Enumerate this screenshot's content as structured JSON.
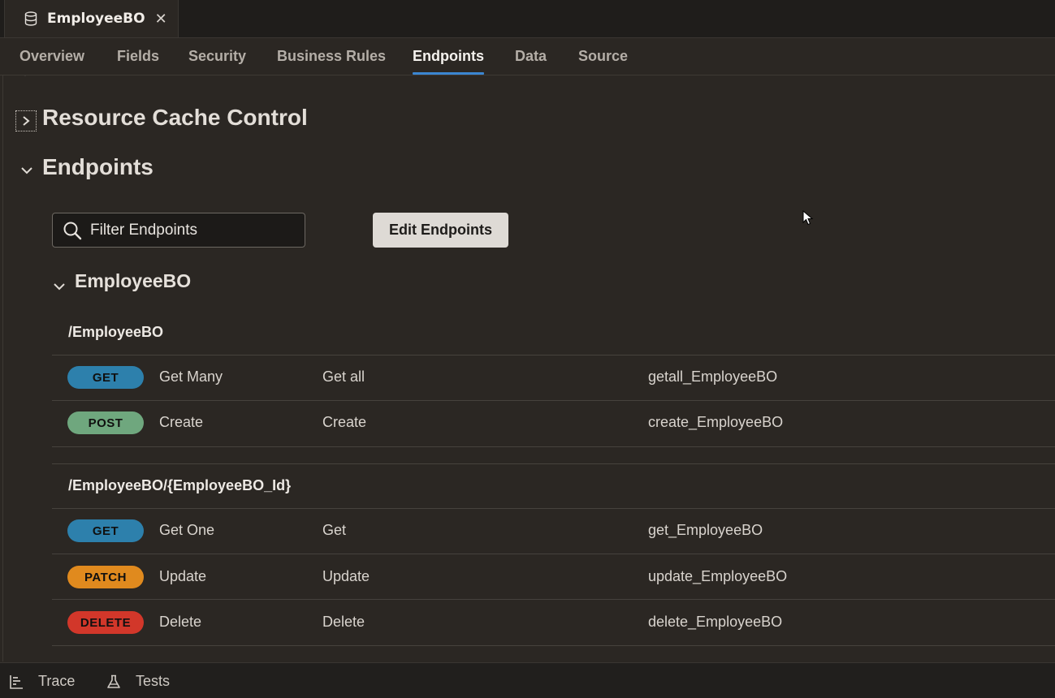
{
  "editor_tab": {
    "title": "EmployeeBO",
    "close": "✕"
  },
  "subtabs": [
    "Overview",
    "Fields",
    "Security",
    "Business Rules",
    "Endpoints",
    "Data",
    "Source"
  ],
  "active_subtab": "Endpoints",
  "sections": {
    "resource_cache_control": "Resource Cache Control",
    "endpoints": "Endpoints"
  },
  "filter": {
    "placeholder": "Filter Endpoints",
    "value": ""
  },
  "edit_button": "Edit Endpoints",
  "group": {
    "title": "EmployeeBO",
    "paths": [
      {
        "path": "/EmployeeBO",
        "rows": [
          {
            "method": "GET",
            "name": "Get Many",
            "title": "Get all",
            "id": "getall_EmployeeBO",
            "color": "#2d80ac"
          },
          {
            "method": "POST",
            "name": "Create",
            "title": "Create",
            "id": "create_EmployeeBO",
            "color": "#6fa77e"
          }
        ]
      },
      {
        "path": "/EmployeeBO/{EmployeeBO_Id}",
        "rows": [
          {
            "method": "GET",
            "name": "Get One",
            "title": "Get",
            "id": "get_EmployeeBO",
            "color": "#2d80ac"
          },
          {
            "method": "PATCH",
            "name": "Update",
            "title": "Update",
            "id": "update_EmployeeBO",
            "color": "#e08a1e"
          },
          {
            "method": "DELETE",
            "name": "Delete",
            "title": "Delete",
            "id": "delete_EmployeeBO",
            "color": "#d2372a"
          }
        ]
      }
    ]
  },
  "bottom_bar": {
    "trace": "Trace",
    "tests": "Tests"
  },
  "colors": {
    "accent": "#3b86d1",
    "background": "#2b2723"
  }
}
